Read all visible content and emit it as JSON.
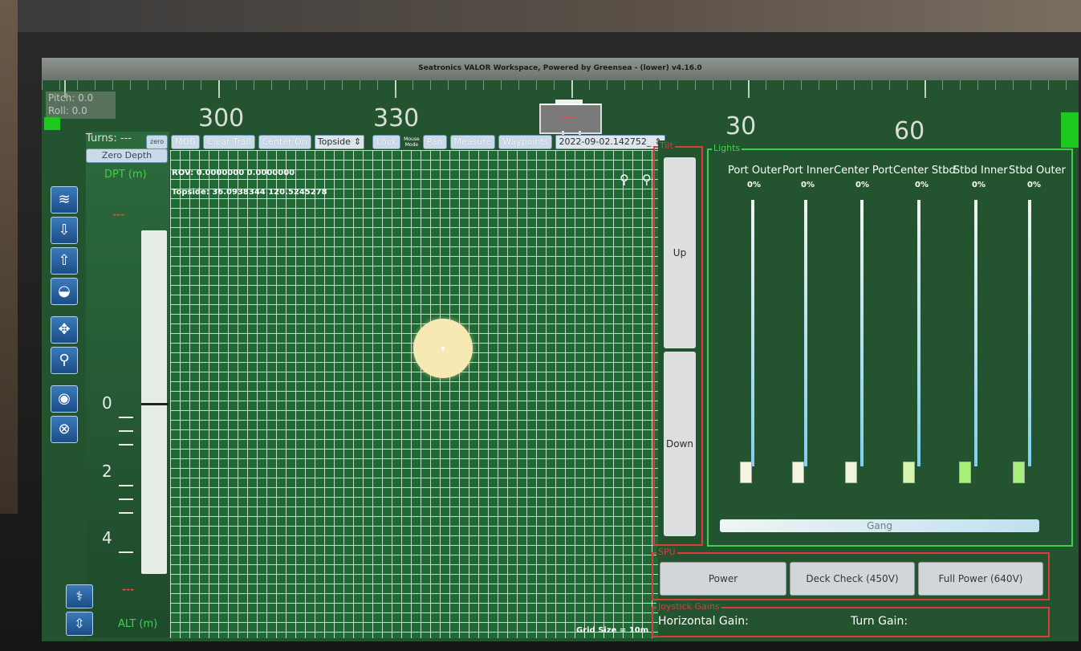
{
  "window": {
    "title": "Seatronics VALOR Workspace, Powered by Greensea - (lower) v4.16.0"
  },
  "attitude": {
    "pitch": "Pitch: 0.0",
    "roll": "Roll: 0.0"
  },
  "compass": {
    "ticks": [
      "300",
      "330",
      "30",
      "60"
    ],
    "heading": "---"
  },
  "depth": {
    "turns": "Turns: ---",
    "zero_depth_label": "Zero Depth",
    "dpt_label": "DPT (m)",
    "alt_label": "ALT (m)",
    "top_dash": "---",
    "bottom_dash": "---",
    "scale": [
      "0",
      "2",
      "4"
    ]
  },
  "map_toolbar": {
    "zero": "zero",
    "mob": "MOB",
    "clear_trail": "Clear Trail",
    "center_on": "Center On",
    "center_select": "Topside",
    "lock": "Lock",
    "mouse_mode_l1": "Mouse",
    "mouse_mode_l2": "Mode",
    "pan": "Pan",
    "measure": "Measure",
    "waypoints": "Waypoints",
    "log_file": "2022-09-02.142752_"
  },
  "map": {
    "rov_pos": "ROV: 0.0000000 0.0000000",
    "topside_pos": "Topside: 36.0938344 120.5245278",
    "grid_size": "Grid Size = 10m"
  },
  "tilt": {
    "label": "Tilt",
    "up": "Up",
    "down": "Down"
  },
  "lights": {
    "label": "Lights",
    "channels": [
      {
        "name": "Port Outer",
        "pct": "0%",
        "level": 0
      },
      {
        "name": "Port Inner",
        "pct": "0%",
        "level": 0
      },
      {
        "name": "Center Port",
        "pct": "0%",
        "level": 0
      },
      {
        "name": "Center Stbd",
        "pct": "0%",
        "level": 0
      },
      {
        "name": "Stbd Inner",
        "pct": "0%",
        "level": 0
      },
      {
        "name": "Stbd Outer",
        "pct": "0%",
        "level": 0
      }
    ],
    "gang": "Gang"
  },
  "spu": {
    "label": "SPU",
    "power": "Power",
    "deck_check": "Deck Check (450V)",
    "full_power": "Full Power (640V)"
  },
  "joystick": {
    "label": "Joystick Gains",
    "horizontal": "Horizontal Gain:",
    "turn": "Turn Gain:"
  },
  "colors": {
    "panel_bg": "#24532f",
    "alert": "#e03a3a",
    "lights_accent": "#3ad34a",
    "depth_label": "#3fd34a"
  }
}
